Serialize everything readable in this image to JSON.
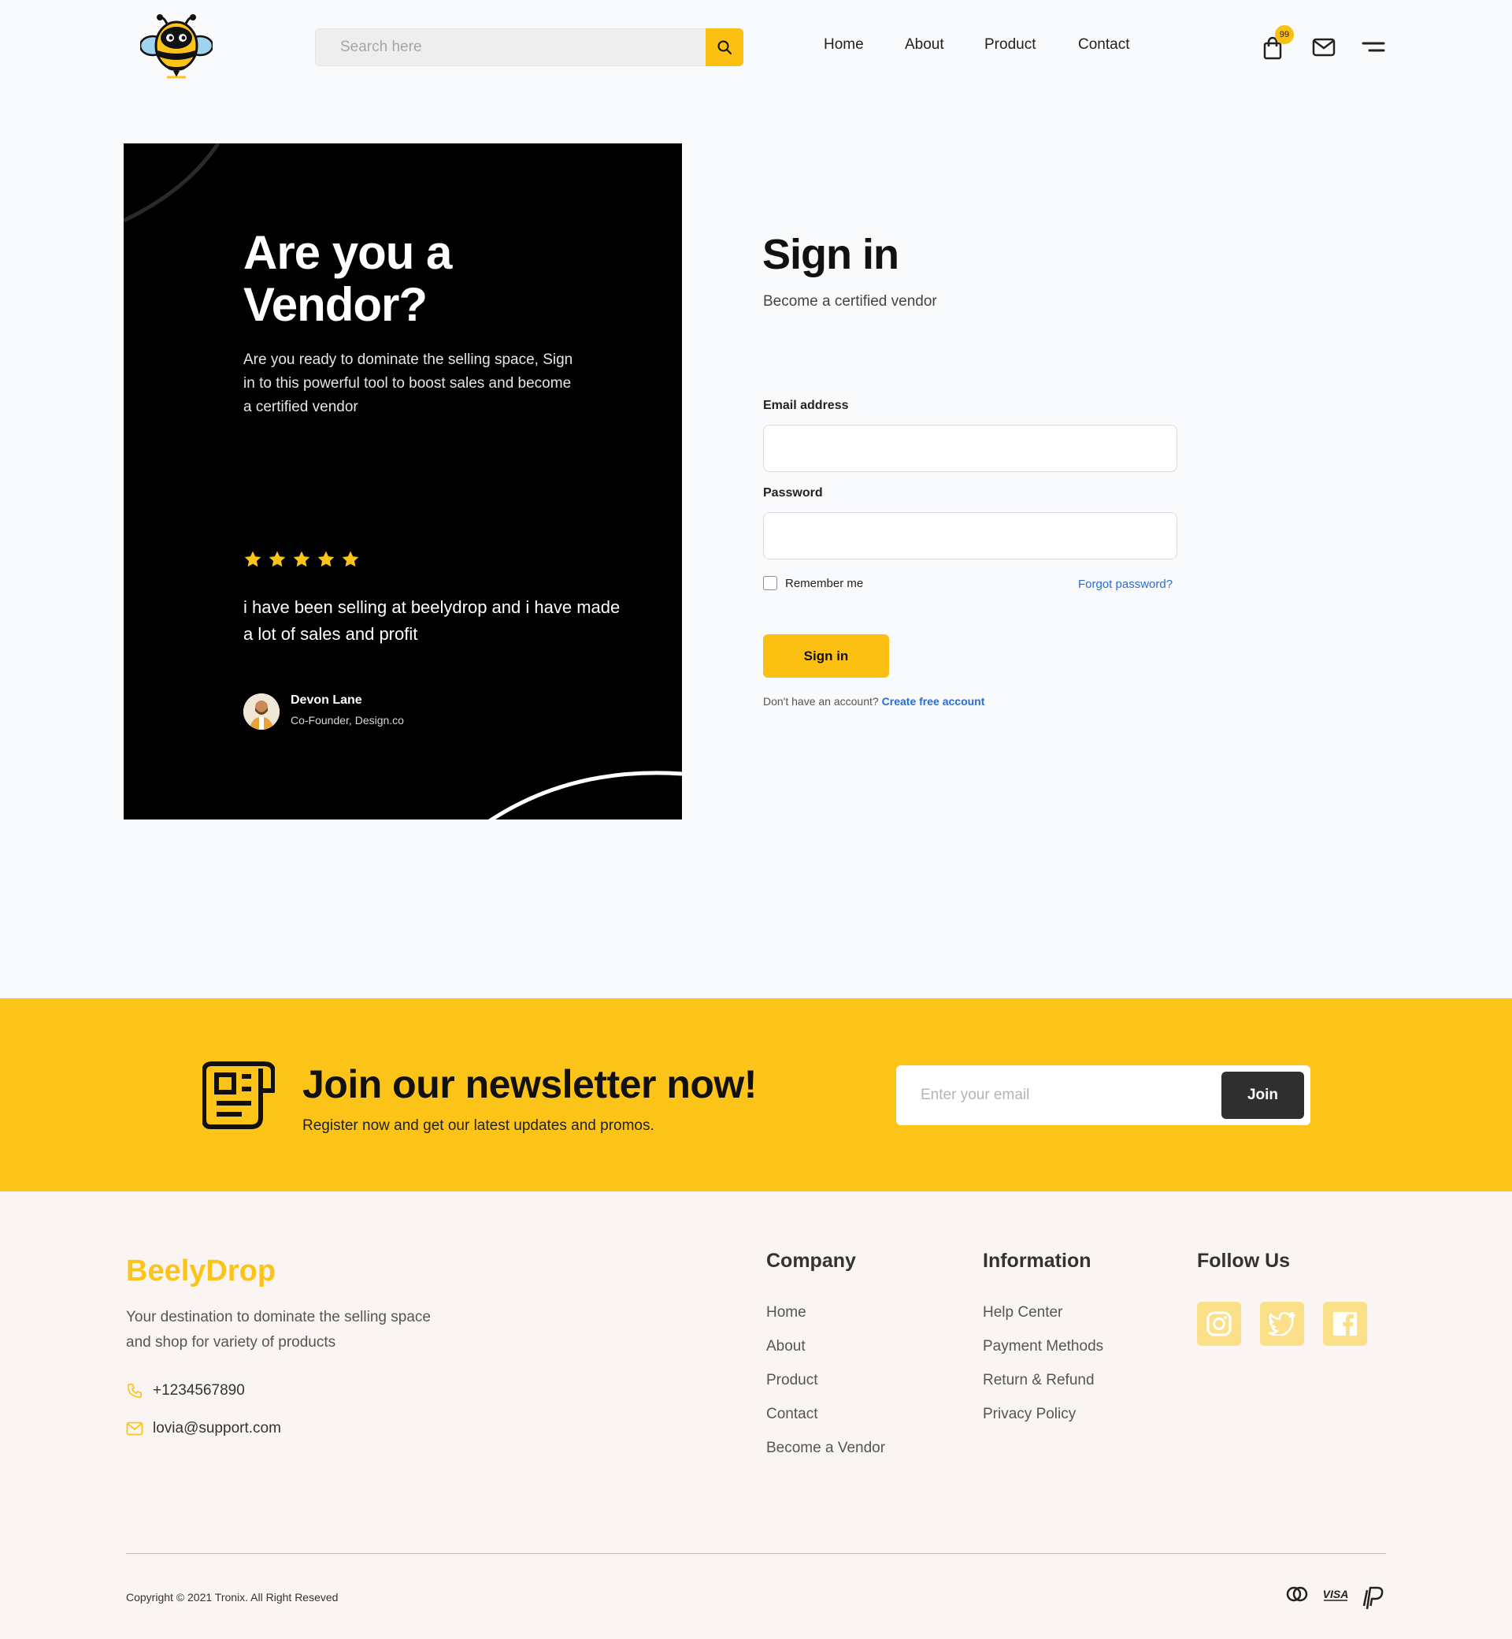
{
  "header": {
    "search_placeholder": "Search here",
    "nav": [
      "Home",
      "About",
      "Product",
      "Contact"
    ],
    "cart_count": "99",
    "icons": {
      "logo": "bee-logo",
      "search": "search-icon",
      "cart": "shopping-bag-icon",
      "mail": "mail-icon",
      "menu": "menu-icon"
    }
  },
  "vendor_panel": {
    "title": "Are you a Vendor?",
    "description": "Are you ready to dominate the selling space, Sign in to this powerful tool to boost sales and become a certified vendor",
    "rating": 5,
    "testimonial": "i have been selling at beelydrop and i have made a lot of sales and profit",
    "author_name": "Devon Lane",
    "author_role": "Co-Founder, Design.co"
  },
  "signin": {
    "title": "Sign in",
    "subtitle": "Become a certified vendor",
    "email_label": "Email address",
    "email_value": "",
    "password_label": "Password",
    "password_value": "",
    "remember_label": "Remember me",
    "remember_checked": false,
    "forgot_label": "Forgot password?",
    "submit_label": "Sign in",
    "no_account_text": "Don't have an account?",
    "create_account_label": "Create free account"
  },
  "newsletter": {
    "title": "Join our newsletter now!",
    "subtitle": "Register now and get our latest updates and promos.",
    "email_placeholder": "Enter your email",
    "join_label": "Join"
  },
  "footer": {
    "brand": "BeelyDrop",
    "description": "Your destination to dominate the selling space and shop for variety of products",
    "phone": "+1234567890",
    "email": "lovia@support.com",
    "company_title": "Company",
    "company_links": [
      "Home",
      "About",
      "Product",
      "Contact",
      "Become a Vendor"
    ],
    "information_title": "Information",
    "information_links": [
      "Help Center",
      "Payment Methods",
      "Return & Refund",
      "Privacy Policy"
    ],
    "follow_title": "Follow Us",
    "social": [
      "instagram-icon",
      "twitter-icon",
      "facebook-icon"
    ],
    "copyright": "Copyright © 2021 Tronix. All Right Reseved",
    "payments": [
      "mastercard-icon",
      "visa-icon",
      "paypal-icon"
    ],
    "accent_color": "#fcc418"
  }
}
